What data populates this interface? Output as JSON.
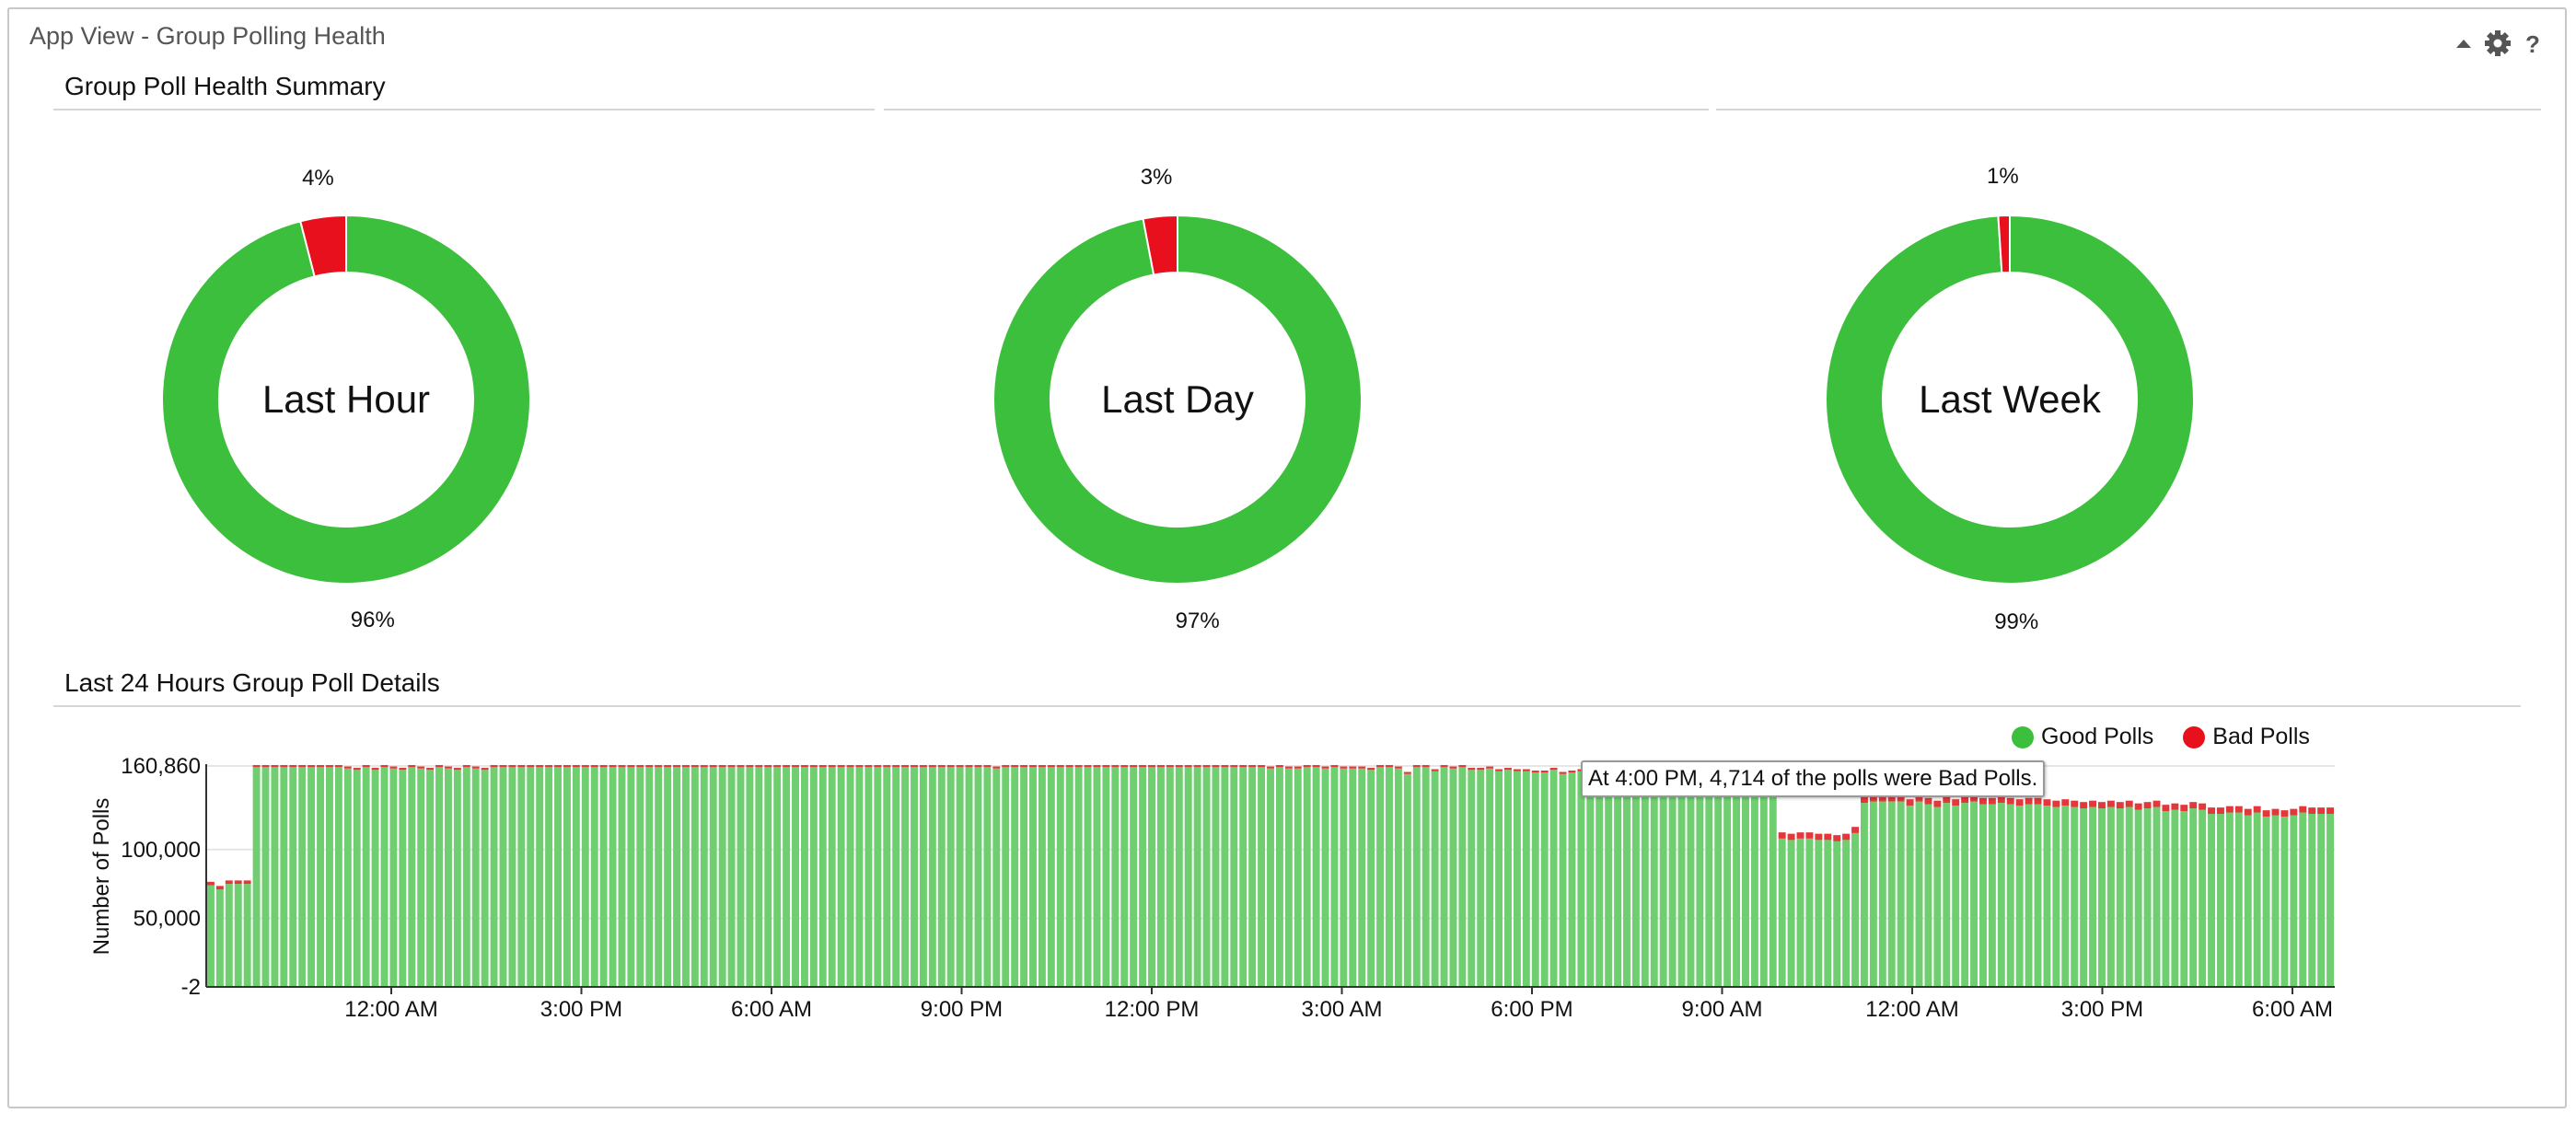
{
  "panel": {
    "title": "App View - Group Polling Health"
  },
  "summary": {
    "title": "Group Poll Health Summary"
  },
  "details": {
    "title": "Last 24 Hours Group Poll Details"
  },
  "colors": {
    "good": "#3cbf3c",
    "bad": "#e8101c",
    "bar_good": "#6fce6f",
    "bar_bad": "#e2383c"
  },
  "donuts": [
    {
      "label": "Last Hour",
      "good_pct": 96,
      "bad_pct": 4,
      "good_text": "96%",
      "bad_text": "4%"
    },
    {
      "label": "Last Day",
      "good_pct": 97,
      "bad_pct": 3,
      "good_text": "97%",
      "bad_text": "3%"
    },
    {
      "label": "Last Week",
      "good_pct": 99,
      "bad_pct": 1,
      "good_text": "99%",
      "bad_text": "1%"
    }
  ],
  "legend": {
    "good": "Good Polls",
    "bad": "Bad Polls"
  },
  "tooltip": {
    "text": "At 4:00 PM, 4,714 of the polls were Bad Polls."
  },
  "chart_data": {
    "type": "bar",
    "ylabel": "Number of Polls",
    "xlabel": "",
    "y_ticks": [
      "160,860",
      "100,000",
      "50,000",
      "-2"
    ],
    "ylim": [
      -2,
      160860
    ],
    "x_ticks": [
      "12:00 AM",
      "3:00 PM",
      "6:00 AM",
      "9:00 PM",
      "12:00 PM",
      "3:00 AM",
      "6:00 PM",
      "9:00 AM",
      "12:00 AM",
      "3:00 PM",
      "6:00 AM"
    ],
    "series": [
      {
        "name": "Good Polls",
        "values": [
          74000,
          71000,
          75000,
          75000,
          75000,
          160000,
          160000,
          160000,
          160000,
          160000,
          160000,
          160000,
          160000,
          160000,
          160000,
          159000,
          158000,
          160000,
          158000,
          160000,
          159000,
          158000,
          160000,
          159000,
          158000,
          160000,
          159000,
          158000,
          160000,
          159000,
          158000,
          160000,
          160000,
          160000,
          160000,
          160000,
          160000,
          160000,
          160000,
          160000,
          160000,
          160000,
          160000,
          160000,
          160000,
          160000,
          160000,
          160000,
          160000,
          160000,
          160000,
          160000,
          160000,
          160000,
          160000,
          160000,
          160000,
          160000,
          160000,
          160000,
          160000,
          160000,
          160000,
          160000,
          160000,
          160000,
          160000,
          160000,
          160000,
          160000,
          160000,
          160000,
          160000,
          160000,
          160000,
          160000,
          160000,
          160000,
          160000,
          160000,
          160000,
          160000,
          160000,
          160000,
          160000,
          160000,
          159000,
          160000,
          160000,
          160000,
          160000,
          160000,
          160000,
          160000,
          160000,
          160000,
          160000,
          160000,
          160000,
          160000,
          160000,
          160000,
          160000,
          160000,
          160000,
          160000,
          160000,
          160000,
          160000,
          160000,
          160000,
          160000,
          160000,
          160000,
          160000,
          160000,
          159000,
          160000,
          159000,
          159000,
          160000,
          160000,
          159000,
          160000,
          159000,
          159000,
          159000,
          158000,
          160000,
          160000,
          159000,
          155000,
          160000,
          160000,
          157000,
          160000,
          159000,
          160000,
          158000,
          158000,
          159000,
          157000,
          158000,
          157000,
          157000,
          156000,
          156000,
          158000,
          155000,
          156000,
          157000,
          155000,
          156000,
          157000,
          155000,
          156000,
          155000,
          150000,
          150000,
          150000,
          150000,
          150000,
          150000,
          150000,
          150000,
          150000,
          150000,
          150000,
          150000,
          150000,
          150000,
          149000,
          108000,
          107000,
          108000,
          108000,
          107000,
          107000,
          106000,
          107000,
          112000,
          134000,
          135000,
          135000,
          135000,
          135000,
          132000,
          135000,
          133000,
          131000,
          134000,
          132000,
          134000,
          135000,
          133000,
          133000,
          134000,
          133000,
          132000,
          133000,
          133000,
          132000,
          131000,
          132000,
          131000,
          130000,
          131000,
          130000,
          131000,
          130000,
          131000,
          129000,
          130000,
          131000,
          128000,
          129000,
          128000,
          130000,
          129000,
          126000,
          126000,
          127000,
          127000,
          125000,
          127000,
          124000,
          125000,
          124000,
          125000,
          127000,
          126000,
          126000,
          126000
        ]
      },
      {
        "name": "Bad Polls",
        "values": [
          2500,
          2500,
          2500,
          2500,
          2500,
          1500,
          1500,
          1500,
          1500,
          1500,
          1500,
          1500,
          1500,
          1500,
          1500,
          1500,
          1500,
          1500,
          1500,
          1500,
          1500,
          1500,
          1500,
          1500,
          1500,
          1500,
          1500,
          1500,
          1500,
          1500,
          1500,
          1500,
          1500,
          1500,
          1500,
          1500,
          1500,
          1500,
          1500,
          1500,
          1500,
          1500,
          1500,
          1500,
          1500,
          1500,
          1500,
          1500,
          1500,
          1500,
          1500,
          1500,
          1500,
          1500,
          1500,
          1500,
          1500,
          1500,
          1500,
          1500,
          1500,
          1500,
          1500,
          1500,
          1500,
          1500,
          1500,
          1500,
          1500,
          1500,
          1500,
          1500,
          1500,
          1500,
          1500,
          1500,
          1500,
          1500,
          1500,
          1500,
          1500,
          1500,
          1500,
          1500,
          1500,
          1500,
          1500,
          1500,
          1500,
          1500,
          1500,
          1500,
          1500,
          1500,
          1500,
          1500,
          1500,
          1500,
          1500,
          1500,
          1500,
          1500,
          1500,
          1500,
          1500,
          1500,
          1500,
          1500,
          1500,
          1500,
          1500,
          1500,
          1500,
          1500,
          1500,
          1500,
          1500,
          1500,
          1500,
          1500,
          1500,
          1500,
          1500,
          1500,
          1500,
          1500,
          1500,
          1500,
          1500,
          1500,
          1500,
          1500,
          1500,
          1500,
          1500,
          1500,
          1500,
          1500,
          1500,
          1500,
          1500,
          1500,
          1500,
          1500,
          1500,
          1500,
          1500,
          1500,
          1500,
          1500,
          1500,
          1500,
          1500,
          1500,
          1500,
          1500,
          1500,
          1500,
          1500,
          1500,
          1500,
          1500,
          1500,
          1500,
          1500,
          1500,
          1500,
          1500,
          1500,
          1500,
          1500,
          1500,
          4500,
          4500,
          4500,
          4500,
          4500,
          4500,
          4500,
          4500,
          4500,
          4500,
          4714,
          4600,
          4600,
          4600,
          4600,
          4600,
          4600,
          4600,
          4600,
          4600,
          4600,
          4600,
          4600,
          4600,
          4600,
          4600,
          4600,
          4600,
          4600,
          4600,
          4600,
          4600,
          4600,
          4600,
          4600,
          4600,
          4600,
          4600,
          4600,
          4600,
          4600,
          4600,
          4600,
          4600,
          4600,
          4600,
          4600,
          4600,
          4600,
          4600,
          4600,
          4600,
          4600,
          4600,
          4600,
          4600,
          4600,
          4600,
          4600,
          4600,
          4600,
          4600
        ]
      }
    ]
  }
}
